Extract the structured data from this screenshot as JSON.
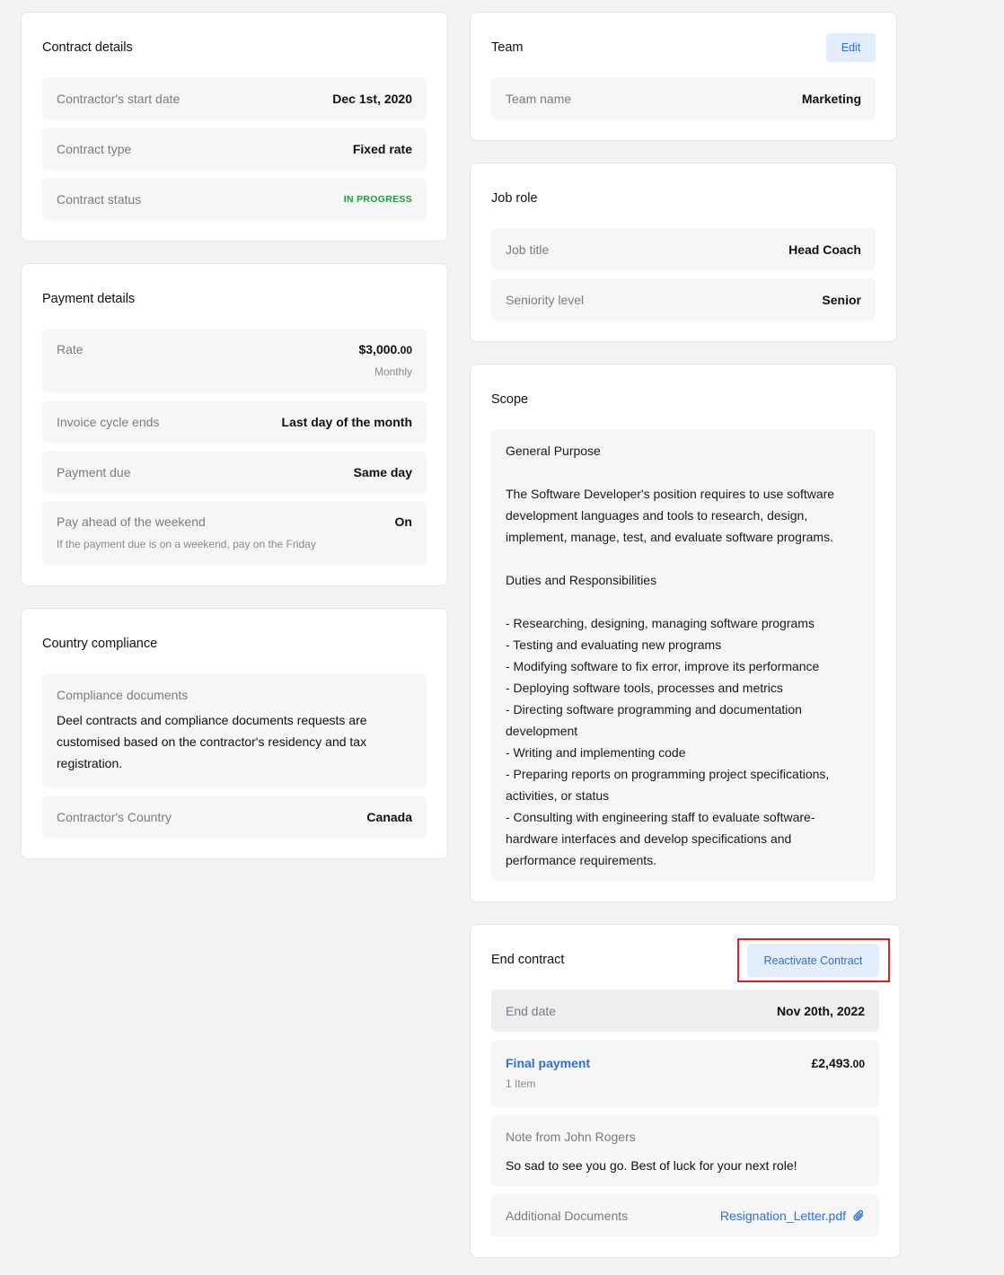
{
  "contract": {
    "title": "Contract details",
    "start_label": "Contractor's start date",
    "start_value": "Dec 1st, 2020",
    "type_label": "Contract type",
    "type_value": "Fixed rate",
    "status_label": "Contract status",
    "status_value": "IN PROGRESS"
  },
  "payment": {
    "title": "Payment details",
    "rate_label": "Rate",
    "rate_main": "$3,000",
    "rate_cents": ".00",
    "rate_period": "Monthly",
    "invoice_label": "Invoice cycle ends",
    "invoice_value": "Last day of the month",
    "due_label": "Payment due",
    "due_value": "Same day",
    "ahead_label": "Pay ahead of the weekend",
    "ahead_value": "On",
    "ahead_note": "If the payment due is on a weekend, pay on the Friday"
  },
  "compliance": {
    "title": "Country compliance",
    "docs_label": "Compliance documents",
    "docs_text": "Deel contracts and compliance documents requests are customised based on the contractor's residency and tax registration.",
    "country_label": "Contractor's Country",
    "country_value": "Canada"
  },
  "team": {
    "title": "Team",
    "edit_label": "Edit",
    "name_label": "Team name",
    "name_value": "Marketing"
  },
  "job": {
    "title": "Job role",
    "title_label": "Job title",
    "title_value": "Head Coach",
    "seniority_label": "Seniority level",
    "seniority_value": "Senior"
  },
  "scope": {
    "title": "Scope",
    "text": "General Purpose\n\nThe Software Developer's position requires to use software development languages and tools to research, design, implement, manage, test, and evaluate software programs.\n\nDuties and Responsibilities\n\n- Researching, designing, managing software programs\n- Testing and evaluating new programs\n- Modifying software to fix error, improve its performance\n- Deploying software tools, processes and metrics\n- Directing software programming and documentation development\n- Writing and implementing code\n- Preparing reports on programming project specifications, activities, or status\n- Consulting with engineering staff to evaluate software-hardware interfaces and develop specifications and performance requirements."
  },
  "end": {
    "title": "End contract",
    "reactivate_label": "Reactivate Contract",
    "end_date_label": "End date",
    "end_date_value": "Nov 20th, 2022",
    "final_payment_label": "Final payment",
    "final_payment_main": "£2,493",
    "final_payment_cents": ".00",
    "final_payment_items": "1 Item",
    "note_label": "Note from John Rogers",
    "note_text": "So sad to see you go. Best of luck for your next role!",
    "docs_label": "Additional Documents",
    "docs_file": "Resignation_Letter.pdf"
  },
  "colors": {
    "accent": "#2f6fd8",
    "status_green": "#1b9b3a",
    "highlight_red": "#d62027"
  },
  "icons": {
    "attachment": "paperclip-icon"
  }
}
